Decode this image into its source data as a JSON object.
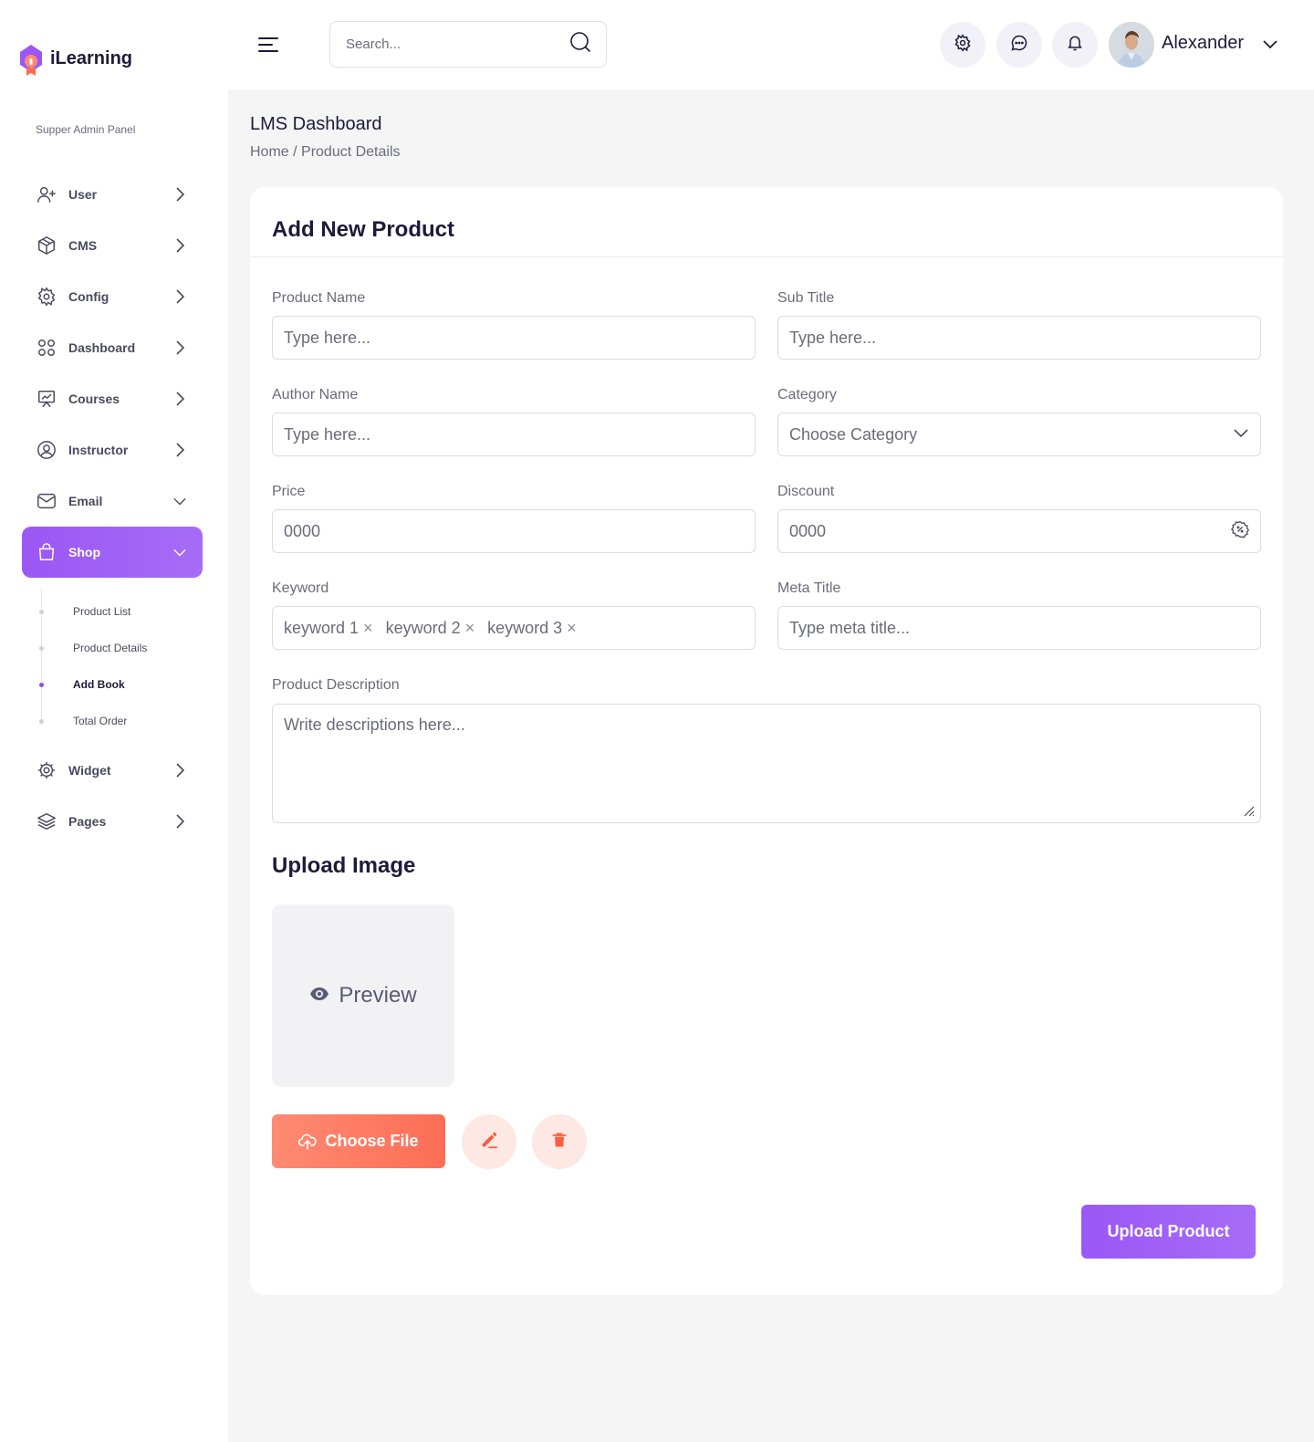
{
  "brand": {
    "name": "iLearning"
  },
  "sidebar": {
    "panel_label": "Supper Admin Panel",
    "items": [
      {
        "label": "User",
        "icon": "user-plus-icon"
      },
      {
        "label": "CMS",
        "icon": "cube-icon"
      },
      {
        "label": "Config",
        "icon": "gear-icon"
      },
      {
        "label": "Dashboard",
        "icon": "grid-icon"
      },
      {
        "label": "Courses",
        "icon": "presentation-icon"
      },
      {
        "label": "Instructor",
        "icon": "user-circle-icon"
      },
      {
        "label": "Email",
        "icon": "mail-icon"
      },
      {
        "label": "Shop",
        "icon": "shopping-bag-icon"
      },
      {
        "label": "Widget",
        "icon": "widget-icon"
      },
      {
        "label": "Pages",
        "icon": "layers-icon"
      }
    ],
    "shop_sub": [
      {
        "label": "Product List"
      },
      {
        "label": "Product Details"
      },
      {
        "label": "Add Book"
      },
      {
        "label": "Total Order"
      }
    ],
    "active_item": "Shop",
    "active_sub": "Add Book"
  },
  "header": {
    "search_placeholder": "Search...",
    "user_name": "Alexander"
  },
  "page": {
    "title": "LMS Dashboard",
    "breadcrumb": "Home / Product Details"
  },
  "form": {
    "title": "Add New Product",
    "product_name": {
      "label": "Product Name",
      "placeholder": "Type here..."
    },
    "sub_title": {
      "label": "Sub Title",
      "placeholder": "Type here..."
    },
    "author_name": {
      "label": "Author Name",
      "placeholder": "Type here..."
    },
    "category": {
      "label": "Category",
      "value": "Choose Category"
    },
    "price": {
      "label": "Price",
      "placeholder": "0000"
    },
    "discount": {
      "label": "Discount",
      "placeholder": "0000"
    },
    "keyword": {
      "label": "Keyword",
      "tags": [
        "keyword 1",
        "keyword 2",
        "keyword 3"
      ],
      "remove_glyph": "×"
    },
    "meta_title": {
      "label": "Meta Title",
      "placeholder": "Type meta title..."
    },
    "description": {
      "label": "Product Description",
      "placeholder": "Write descriptions here..."
    },
    "upload_title": "Upload Image",
    "preview_label": "Preview",
    "choose_file": "Choose File",
    "submit": "Upload Product"
  },
  "colors": {
    "accent": "#9b57f5",
    "coral": "#fd6d55",
    "text": "#1c1b3a",
    "muted": "#6b6b7b"
  }
}
